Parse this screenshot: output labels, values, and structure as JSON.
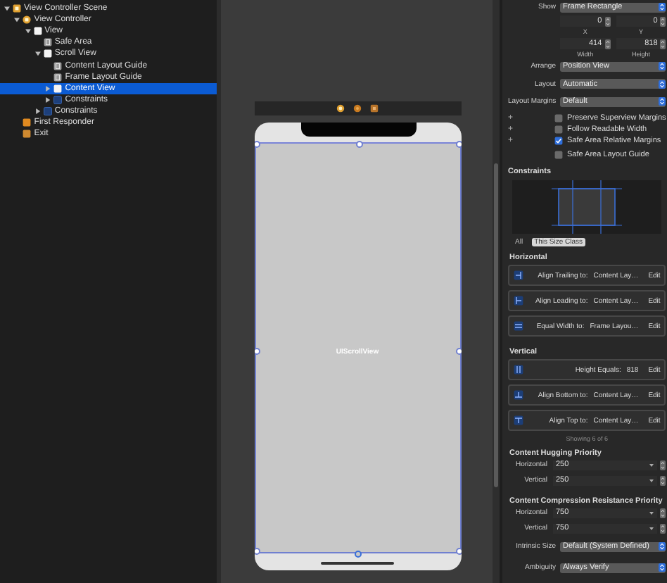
{
  "navigator": {
    "items": [
      {
        "label": "View Controller Scene",
        "kind": "scene",
        "expanded": true,
        "selected": false,
        "children": [
          {
            "label": "View Controller",
            "kind": "controller",
            "expanded": true,
            "selected": false,
            "children": [
              {
                "label": "View",
                "kind": "view",
                "expanded": true,
                "selected": false,
                "children": [
                  {
                    "label": "Safe Area",
                    "kind": "guide",
                    "selected": false
                  },
                  {
                    "label": "Scroll View",
                    "kind": "view",
                    "expanded": true,
                    "selected": false,
                    "children": [
                      {
                        "label": "Content Layout Guide",
                        "kind": "guide",
                        "selected": false
                      },
                      {
                        "label": "Frame Layout Guide",
                        "kind": "guide",
                        "selected": false
                      },
                      {
                        "label": "Content View",
                        "kind": "view",
                        "expanded": false,
                        "selected": true
                      },
                      {
                        "label": "Constraints",
                        "kind": "constraints",
                        "expanded": false,
                        "selected": false
                      }
                    ]
                  },
                  {
                    "label": "Constraints",
                    "kind": "constraints",
                    "expanded": false,
                    "selected": false
                  }
                ]
              }
            ]
          },
          {
            "label": "First Responder",
            "kind": "responder",
            "selected": false
          },
          {
            "label": "Exit",
            "kind": "exit",
            "selected": false
          }
        ]
      }
    ]
  },
  "canvas": {
    "view_label": "UIScrollView"
  },
  "inspector": {
    "frame": {
      "label": "Show",
      "value": "Frame Rectangle"
    },
    "position": [
      {
        "value": "0",
        "label": "X"
      },
      {
        "value": "0",
        "label": "Y"
      }
    ],
    "size": [
      {
        "value": "414",
        "label": "Width"
      },
      {
        "value": "818",
        "label": "Height"
      }
    ],
    "popups": [
      {
        "label": "Arrange",
        "value": "Position View"
      },
      {
        "label": "Layout",
        "value": "Automatic"
      },
      {
        "label": "Layout Margins",
        "value": "Default"
      }
    ],
    "options": [
      {
        "plus": "+",
        "label": "Preserve Superview Margins",
        "checked": false
      },
      {
        "plus": "+",
        "label": "Follow Readable Width",
        "checked": false
      },
      {
        "plus": "+",
        "label": "Safe Area Relative Margins",
        "checked": true
      },
      {
        "label": "Safe Area Layout Guide",
        "checked": false
      }
    ],
    "constraints_title": "Constraints",
    "size_class_tabs": [
      {
        "label": "All",
        "selected": false
      },
      {
        "label": "This Size Class",
        "selected": true
      }
    ],
    "constraint_groups": [
      {
        "title": "Horizontal",
        "items": [
          {
            "kind": "trailing",
            "text": "Align Trailing to:",
            "target": "Content Lay…",
            "action": "Edit"
          },
          {
            "kind": "leading",
            "text": "Align Leading to:",
            "target": "Content Lay…",
            "action": "Edit"
          },
          {
            "kind": "width",
            "text": "Equal Width to:",
            "target": "Frame Layou…",
            "action": "Edit"
          }
        ]
      },
      {
        "title": "Vertical",
        "items": [
          {
            "kind": "height",
            "text": "Height Equals:",
            "target": "818",
            "action": "Edit"
          },
          {
            "kind": "bottom",
            "text": "Align Bottom to:",
            "target": "Content Lay…",
            "action": "Edit"
          },
          {
            "kind": "top",
            "text": "Align Top to:",
            "target": "Content Lay…",
            "action": "Edit"
          }
        ]
      }
    ],
    "summary": "Showing 6 of 6",
    "priorities": [
      {
        "title": "Content Hugging Priority",
        "rows": [
          {
            "label": "Horizontal",
            "value": "250"
          },
          {
            "label": "Vertical",
            "value": "250"
          }
        ]
      },
      {
        "title": "Content Compression Resistance Priority",
        "rows": [
          {
            "label": "Horizontal",
            "value": "750"
          },
          {
            "label": "Vertical",
            "value": "750"
          }
        ]
      }
    ],
    "bottom_popups": [
      {
        "label": "Intrinsic Size",
        "value": "Default (System Defined)"
      },
      {
        "label": "Ambiguity",
        "value": "Always Verify"
      }
    ]
  }
}
